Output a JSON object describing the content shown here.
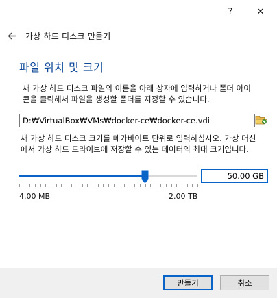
{
  "titlebar": {
    "help_label": "?",
    "close_label": "✕"
  },
  "header": {
    "back_icon": "arrow-left-icon",
    "title": "가상 하드 디스크 만들기"
  },
  "section": {
    "title": "파일 위치 및 크기"
  },
  "location": {
    "description": "새 가상 하드 디스크 파일의 이름을 아래 상자에 입력하거나 폴더 아이콘을 클릭해서 파일을 생성할 폴더를 지정할 수 있습니다.",
    "path_value": "D:₩VirtualBox₩VMs₩docker-ce₩docker-ce.vdi",
    "folder_icon": "folder-open-icon"
  },
  "size": {
    "description": "새 가상 하드 디스크 크기를 메가바이트 단위로 입력하십시오. 가상 머신에서 가상 하드 드라이브에 저장할 수 있는 데이터의 최대 크기입니다.",
    "value": "50.00 GB",
    "slider_fraction": 0.705,
    "min_label": "4.00 MB",
    "max_label": "2.00 TB"
  },
  "footer": {
    "create_label": "만들기",
    "cancel_label": "취소"
  },
  "colors": {
    "accent": "#0a64c8",
    "section_title": "#0f4a99",
    "footer_bg": "#f0f0f0"
  }
}
